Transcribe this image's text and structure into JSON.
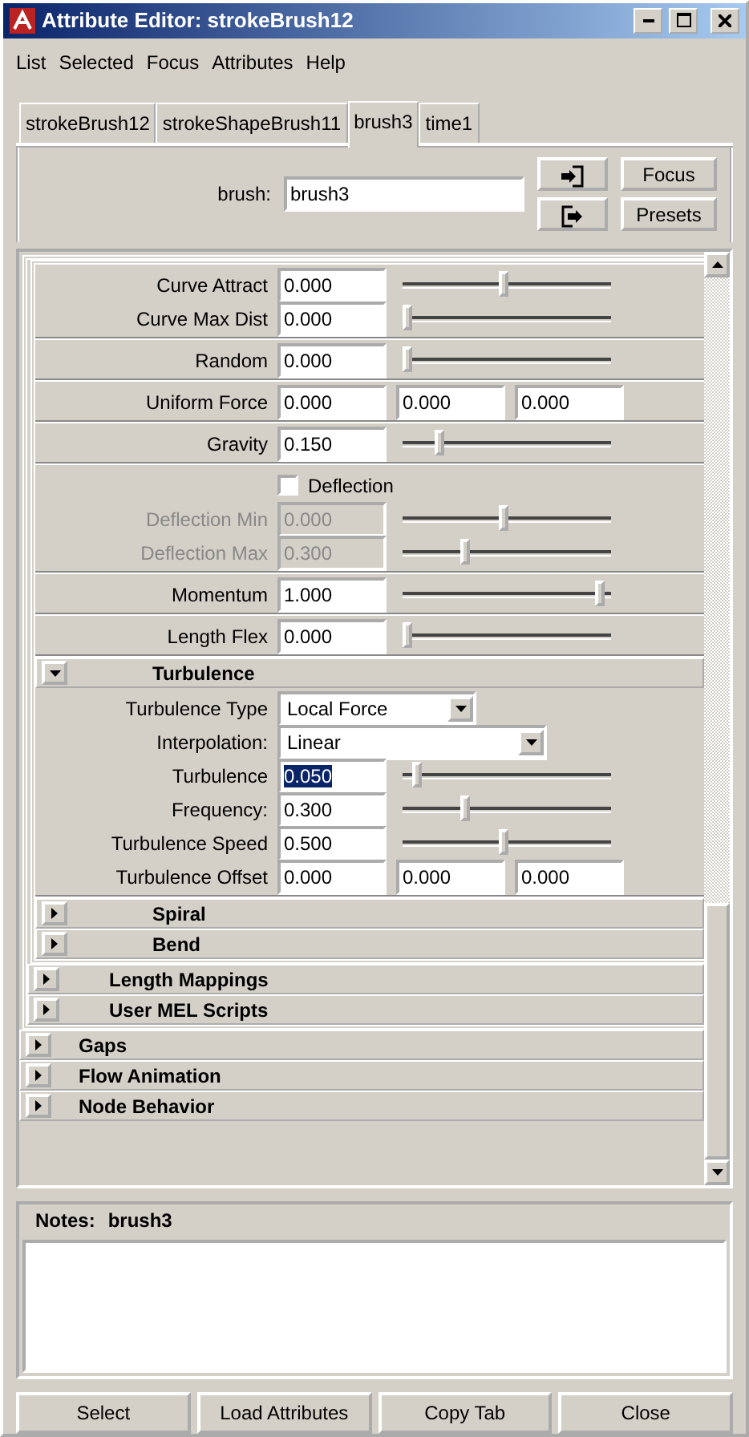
{
  "window": {
    "title": "Attribute Editor: strokeBrush12"
  },
  "menu": [
    "List",
    "Selected",
    "Focus",
    "Attributes",
    "Help"
  ],
  "tabs": [
    {
      "label": "strokeBrush12",
      "selected": false
    },
    {
      "label": "strokeShapeBrush11",
      "selected": false
    },
    {
      "label": "brush3",
      "selected": true
    },
    {
      "label": "time1",
      "selected": false
    }
  ],
  "node": {
    "label": "brush:",
    "value": "brush3",
    "buttons": [
      "Focus",
      "Presets"
    ]
  },
  "sections": [
    {
      "expanded": true,
      "children": [
        {
          "expanded": true,
          "groups": [
            [
              {
                "kind": "slider",
                "label": "Curve Attract",
                "value": "0.000",
                "level": 0.5,
                "disabled": false,
                "highlighted": false
              },
              {
                "kind": "slider",
                "label": "Curve Max Dist",
                "value": "0.000",
                "level": 0,
                "disabled": false,
                "highlighted": false
              }
            ],
            [
              {
                "kind": "slider",
                "label": "Random",
                "value": "0.000",
                "level": 0,
                "disabled": false,
                "highlighted": false
              }
            ],
            [
              {
                "kind": "vector",
                "label": "Uniform Force",
                "values": [
                  "0.000",
                  "0.000",
                  "0.000"
                ]
              }
            ],
            [
              {
                "kind": "slider",
                "label": "Gravity",
                "value": "0.150",
                "level": 0.17,
                "disabled": false,
                "highlighted": false
              }
            ],
            [
              {
                "kind": "checkbox",
                "label": "Deflection",
                "checked": false
              },
              {
                "kind": "slider",
                "label": "Deflection Min",
                "value": "0.000",
                "level": 0.5,
                "disabled": true,
                "highlighted": false
              },
              {
                "kind": "slider",
                "label": "Deflection Max",
                "value": "0.300",
                "level": 0.3,
                "disabled": true,
                "highlighted": false
              }
            ],
            [
              {
                "kind": "slider",
                "label": "Momentum",
                "value": "1.000",
                "level": 1,
                "disabled": false,
                "highlighted": false
              }
            ],
            [
              {
                "kind": "slider",
                "label": "Length Flex",
                "value": "0.000",
                "level": 0,
                "disabled": false,
                "highlighted": false
              }
            ]
          ],
          "children": [
            {
              "title": "Turbulence",
              "expanded": true,
              "groups": [
                [
                  {
                    "kind": "dropdown",
                    "label": "Turbulence Type",
                    "value": "Local Force",
                    "wide": false
                  },
                  {
                    "kind": "dropdown",
                    "label": "Interpolation:",
                    "value": "Linear",
                    "wide": true
                  },
                  {
                    "kind": "slider",
                    "label": "Turbulence",
                    "value": "0.050",
                    "level": 0.05,
                    "disabled": false,
                    "highlighted": true
                  },
                  {
                    "kind": "slider",
                    "label": "Frequency:",
                    "value": "0.300",
                    "level": 0.3,
                    "disabled": false,
                    "highlighted": false
                  },
                  {
                    "kind": "slider",
                    "label": "Turbulence Speed",
                    "value": "0.500",
                    "level": 0.5,
                    "disabled": false,
                    "highlighted": false
                  },
                  {
                    "kind": "vector",
                    "label": "Turbulence Offset",
                    "values": [
                      "0.000",
                      "0.000",
                      "0.000"
                    ]
                  }
                ]
              ]
            },
            {
              "title": "Spiral",
              "expanded": false
            },
            {
              "title": "Bend",
              "expanded": false
            }
          ]
        },
        {
          "title": "Length Mappings",
          "expanded": false
        },
        {
          "title": "User MEL Scripts",
          "expanded": false
        }
      ]
    },
    {
      "title": "Gaps",
      "expanded": false
    },
    {
      "title": "Flow Animation",
      "expanded": false
    },
    {
      "title": "Node Behavior",
      "expanded": false
    }
  ],
  "notes": {
    "label": "Notes:",
    "node": "brush3"
  },
  "buttons": [
    "Select",
    "Load Attributes",
    "Copy Tab",
    "Close"
  ]
}
